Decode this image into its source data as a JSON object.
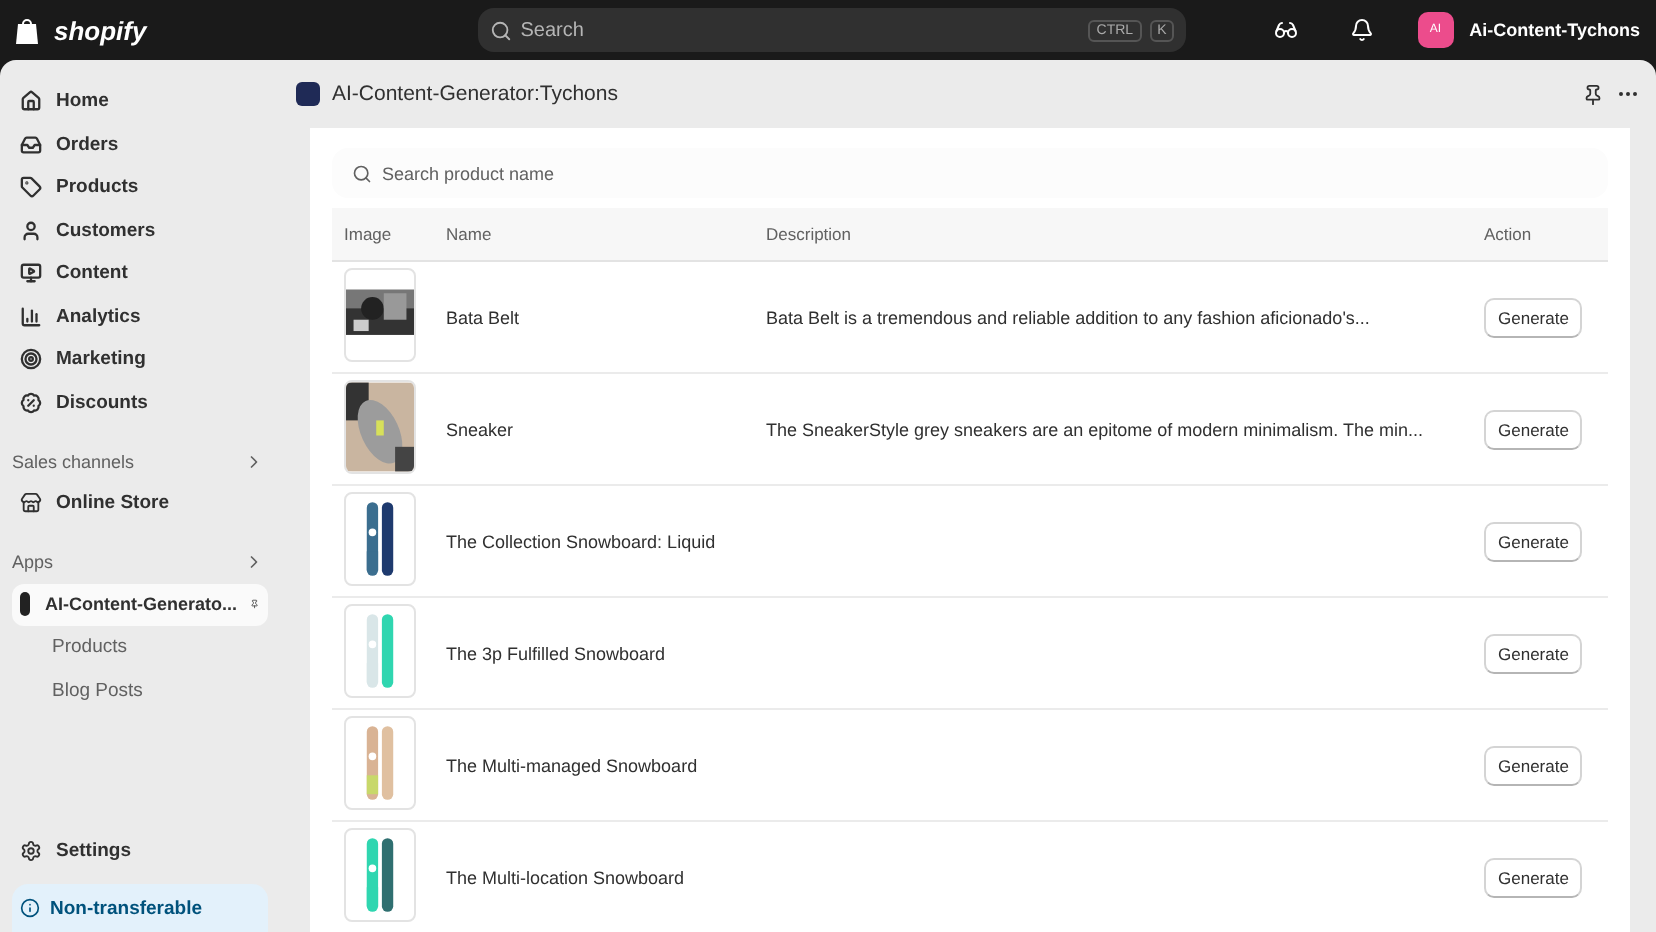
{
  "topbar": {
    "logo_text": "shopify",
    "search": {
      "placeholder": "Search",
      "shortcut_keys": [
        "CTRL",
        "K"
      ]
    },
    "avatar_initials": "AI",
    "store_name": "Ai-Content-Tychons"
  },
  "sidebar": {
    "items": [
      {
        "label": "Home",
        "selected": false
      },
      {
        "label": "Orders",
        "selected": false
      },
      {
        "label": "Products",
        "selected": false
      },
      {
        "label": "Customers",
        "selected": false
      },
      {
        "label": "Content",
        "selected": false
      },
      {
        "label": "Analytics",
        "selected": false
      },
      {
        "label": "Marketing",
        "selected": false
      },
      {
        "label": "Discounts",
        "selected": false
      }
    ],
    "sales_channels": {
      "title": "Sales channels",
      "items": [
        {
          "label": "Online Store",
          "selected": false
        }
      ]
    },
    "apps": {
      "title": "Apps",
      "app": {
        "label": "AI-Content-Generato...",
        "selected": true,
        "children": [
          {
            "label": "Products",
            "selected": false
          },
          {
            "label": "Blog Posts",
            "selected": false
          }
        ]
      }
    },
    "settings": "Settings",
    "notice": "Non-transferable"
  },
  "page": {
    "title": "AI-Content-Generator:Tychons",
    "search": {
      "placeholder": "Search product name"
    },
    "table": {
      "columns": [
        "Image",
        "Name",
        "Description",
        "Action"
      ],
      "rows": [
        {
          "name": "Bata Belt",
          "description": "Bata Belt is a tremendous and reliable addition to any fashion aficionado's...",
          "action": "Generate"
        },
        {
          "name": "Sneaker",
          "description": "The SneakerStyle grey sneakers are an epitome of modern minimalism. The min...",
          "action": "Generate"
        },
        {
          "name": "The Collection Snowboard: Liquid",
          "action": "Generate"
        },
        {
          "name": "The 3p Fulfilled Snowboard",
          "action": "Generate"
        },
        {
          "name": "The Multi-managed Snowboard",
          "action": "Generate"
        },
        {
          "name": "The Multi-location Snowboard",
          "action": "Generate"
        }
      ]
    }
  }
}
